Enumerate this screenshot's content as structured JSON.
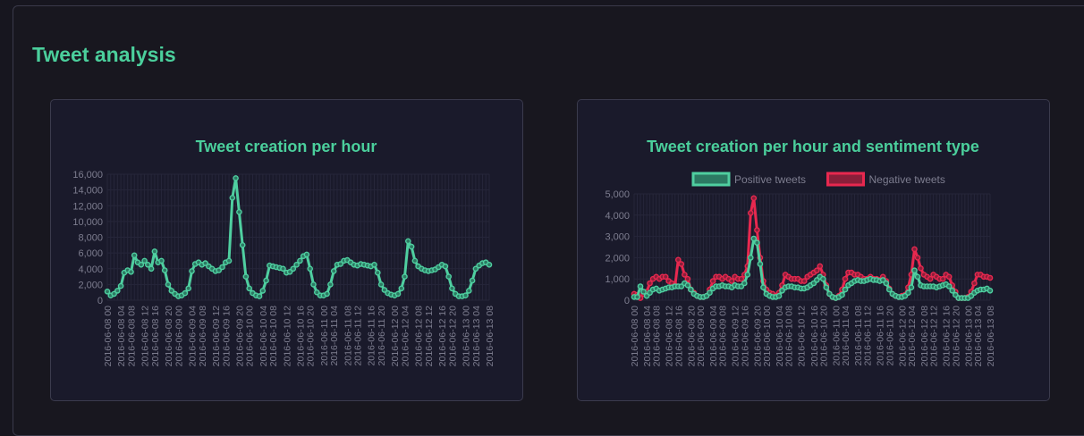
{
  "section": {
    "title": "Tweet analysis"
  },
  "colors": {
    "accent": "#4bcf9c",
    "positive_line": "#4fcfa0",
    "positive_fill": "#2c7a63",
    "negative_line": "#e8284f",
    "negative_fill": "#8a1f3a",
    "tick_text": "#7d7d8f",
    "grid": "#26263a"
  },
  "chart_data": [
    {
      "type": "line",
      "title": "Tweet creation per hour",
      "ylim": [
        0,
        16000
      ],
      "yticks": [
        0,
        2000,
        4000,
        6000,
        8000,
        10000,
        12000,
        14000,
        16000
      ],
      "yticks_labels": [
        "0",
        "2,000",
        "4,000",
        "6,000",
        "8,000",
        "10,000",
        "12,000",
        "14,000",
        "16,000"
      ],
      "tick_labels": [
        "2016-06-08 00",
        "2016-06-08 04",
        "2016-06-08 08",
        "2016-06-08 12",
        "2016-06-08 16",
        "2016-06-08 20",
        "2016-06-09 00",
        "2016-06-09 04",
        "2016-06-09 08",
        "2016-06-09 12",
        "2016-06-09 16",
        "2016-06-09 20",
        "2016-06-10 00",
        "2016-06-10 04",
        "2016-06-10 08",
        "2016-06-10 12",
        "2016-06-10 16",
        "2016-06-10 20",
        "2016-06-11 00",
        "2016-06-11 04",
        "2016-06-11 08",
        "2016-06-11 12",
        "2016-06-11 16",
        "2016-06-11 20",
        "2016-06-12 00",
        "2016-06-12 04",
        "2016-06-12 08",
        "2016-06-12 12",
        "2016-06-12 16",
        "2016-06-12 20",
        "2016-06-13 00",
        "2016-06-13 04",
        "2016-06-13 08"
      ],
      "grid": true,
      "legend": "none",
      "series": [
        {
          "values": [
            1100,
            600,
            800,
            1200,
            1800,
            3500,
            3800,
            3600,
            5700,
            4800,
            4500,
            5000,
            4500,
            4000,
            6200,
            4800,
            5000,
            3800,
            2000,
            1200,
            800,
            500,
            600,
            900,
            1500,
            3700,
            4600,
            4800,
            4500,
            4700,
            4300,
            4000,
            3700,
            3800,
            4200,
            4800,
            5000,
            13000,
            15500,
            11200,
            7000,
            3000,
            1500,
            900,
            600,
            500,
            1200,
            2500,
            4400,
            4300,
            4200,
            4100,
            4000,
            3500,
            3600,
            4000,
            4500,
            5000,
            5600,
            5800,
            4000,
            2000,
            1000,
            600,
            600,
            800,
            2000,
            3700,
            4500,
            4600,
            5000,
            5100,
            4800,
            4500,
            4400,
            4600,
            4500,
            4400,
            4300,
            4500,
            3500,
            2000,
            1300,
            900,
            700,
            600,
            800,
            1500,
            3000,
            7500,
            6800,
            5000,
            4300,
            4000,
            3800,
            3700,
            3800,
            3900,
            4200,
            4500,
            4300,
            3000,
            1500,
            800,
            500,
            500,
            600,
            1200,
            2500,
            4000,
            4400,
            4700,
            4800,
            4500
          ]
        }
      ]
    },
    {
      "type": "line",
      "title": "Tweet creation per hour and sentiment type",
      "ylim": [
        0,
        5000
      ],
      "yticks": [
        0,
        1000,
        2000,
        3000,
        4000,
        5000
      ],
      "yticks_labels": [
        "0",
        "1,000",
        "2,000",
        "3,000",
        "4,000",
        "5,000"
      ],
      "tick_labels": [
        "2016-06-08 00",
        "2016-06-08 04",
        "2016-06-08 08",
        "2016-06-08 12",
        "2016-06-08 16",
        "2016-06-08 20",
        "2016-06-09 00",
        "2016-06-09 04",
        "2016-06-09 08",
        "2016-06-09 12",
        "2016-06-09 16",
        "2016-06-09 20",
        "2016-06-10 00",
        "2016-06-10 04",
        "2016-06-10 08",
        "2016-06-10 12",
        "2016-06-10 16",
        "2016-06-10 20",
        "2016-06-11 00",
        "2016-06-11 04",
        "2016-06-11 08",
        "2016-06-11 12",
        "2016-06-11 16",
        "2016-06-11 20",
        "2016-06-12 00",
        "2016-06-12 04",
        "2016-06-12 08",
        "2016-06-12 12",
        "2016-06-12 16",
        "2016-06-12 20",
        "2016-06-13 00",
        "2016-06-13 04",
        "2016-06-13 08"
      ],
      "grid": true,
      "legend": "top",
      "series": [
        {
          "name": "Positive tweets",
          "values": [
            150,
            150,
            650,
            400,
            200,
            350,
            500,
            550,
            450,
            500,
            550,
            600,
            600,
            650,
            650,
            650,
            800,
            700,
            500,
            300,
            200,
            150,
            150,
            200,
            350,
            550,
            650,
            650,
            700,
            650,
            650,
            600,
            700,
            650,
            650,
            800,
            1200,
            2000,
            2900,
            2700,
            1700,
            600,
            300,
            200,
            150,
            150,
            200,
            450,
            600,
            650,
            650,
            600,
            600,
            550,
            550,
            600,
            700,
            800,
            950,
            1100,
            1000,
            600,
            300,
            150,
            100,
            150,
            250,
            500,
            700,
            800,
            900,
            950,
            900,
            900,
            950,
            1000,
            950,
            950,
            900,
            950,
            800,
            500,
            300,
            200,
            150,
            150,
            200,
            350,
            600,
            1400,
            1100,
            700,
            650,
            650,
            650,
            650,
            600,
            650,
            700,
            750,
            650,
            450,
            250,
            100,
            100,
            100,
            100,
            200,
            350,
            450,
            500,
            500,
            550,
            450
          ]
        },
        {
          "name": "Negative tweets",
          "values": [
            300,
            250,
            100,
            300,
            400,
            800,
            1000,
            1100,
            1000,
            1100,
            1100,
            900,
            800,
            700,
            1900,
            1700,
            1200,
            1000,
            500,
            350,
            200,
            150,
            150,
            200,
            500,
            900,
            1100,
            1100,
            1000,
            1100,
            1000,
            900,
            1100,
            1000,
            1000,
            1200,
            1600,
            4100,
            4800,
            3300,
            2000,
            900,
            500,
            350,
            300,
            200,
            350,
            700,
            1200,
            1100,
            1000,
            1000,
            1000,
            900,
            900,
            1100,
            1200,
            1300,
            1400,
            1600,
            1200,
            700,
            300,
            150,
            100,
            200,
            500,
            1000,
            1300,
            1300,
            1200,
            1200,
            1100,
            1000,
            1000,
            1100,
            1000,
            1000,
            950,
            1100,
            900,
            550,
            300,
            200,
            150,
            200,
            250,
            600,
            1200,
            2400,
            2000,
            1500,
            1200,
            1100,
            1000,
            1200,
            1100,
            1000,
            1000,
            1200,
            1100,
            700,
            400,
            100,
            100,
            100,
            150,
            400,
            800,
            1200,
            1200,
            1100,
            1100,
            1050
          ]
        }
      ]
    }
  ]
}
